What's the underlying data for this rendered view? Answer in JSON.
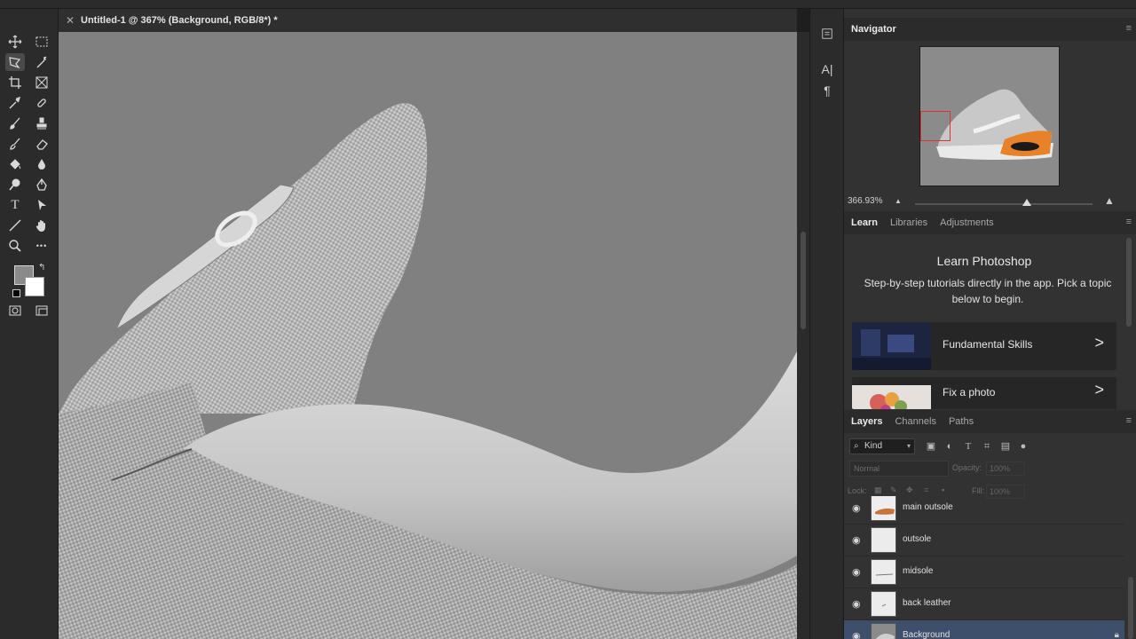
{
  "document": {
    "tab_title": "Untitled-1 @ 367% (Background, RGB/8*) *",
    "close_glyph": "✕"
  },
  "toolbar": {
    "tools": [
      "move-tool",
      "marquee-tool",
      "lasso-tool",
      "magic-wand-tool",
      "crop-tool",
      "frame-tool",
      "eyedropper-tool",
      "healing-brush-tool",
      "brush-tool",
      "clone-stamp-tool",
      "history-brush-tool",
      "eraser-tool",
      "paint-bucket-tool",
      "blur-tool",
      "dodge-tool",
      "pen-tool",
      "type-tool",
      "path-selection-tool",
      "line-tool",
      "hand-tool",
      "zoom-tool",
      "more-tools"
    ],
    "type_glyph": "T",
    "more_glyph": "•••",
    "swap_glyph": "↰",
    "foreground_color": "#8a8a8a",
    "background_color": "#ffffff"
  },
  "dock": {
    "character_glyph": "A|",
    "paragraph_glyph": "¶"
  },
  "navigator": {
    "title": "Navigator",
    "zoom_value": "366.93%",
    "menu_glyph": "≡"
  },
  "learn_panel": {
    "tabs": [
      "Learn",
      "Libraries",
      "Adjustments"
    ],
    "heading": "Learn Photoshop",
    "description": "Step-by-step tutorials directly in the app. Pick a topic below to begin.",
    "cards": [
      {
        "label": "Fundamental Skills",
        "chevron": ">"
      },
      {
        "label": "Fix a photo",
        "chevron": ">"
      }
    ]
  },
  "layers_panel": {
    "tabs": [
      "Layers",
      "Channels",
      "Paths"
    ],
    "filter_kind": "Kind",
    "blend_mode": "Normal",
    "opacity_label": "Opacity:",
    "opacity_value": "100%",
    "lock_label": "Lock:",
    "fill_label": "Fill:",
    "fill_value": "100%",
    "eye_glyph": "◉",
    "layers": [
      {
        "name": "main outsole",
        "selected": false
      },
      {
        "name": "outsole",
        "selected": false
      },
      {
        "name": "midsole",
        "selected": false
      },
      {
        "name": "back leather",
        "selected": false
      },
      {
        "name": "Background",
        "selected": true
      }
    ]
  },
  "colors": {
    "canvas_bg": "#808080",
    "accent_orange": "#e8822a",
    "nav_view_box": "#e03030",
    "selected_layer": "#3d4f6b"
  }
}
